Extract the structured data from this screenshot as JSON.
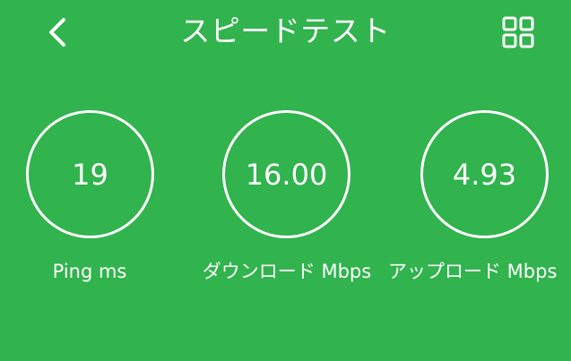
{
  "theme": {
    "background": "#31b34d",
    "foreground": "#ffffff"
  },
  "header": {
    "title": "スピードテスト",
    "back_icon": "chevron-left-icon",
    "grid_icon": "grid-icon"
  },
  "metrics": [
    {
      "value": "19",
      "label": "Ping ms"
    },
    {
      "value": "16.00",
      "label": "ダウンロード Mbps"
    },
    {
      "value": "4.93",
      "label": "アップロード Mbps"
    }
  ]
}
